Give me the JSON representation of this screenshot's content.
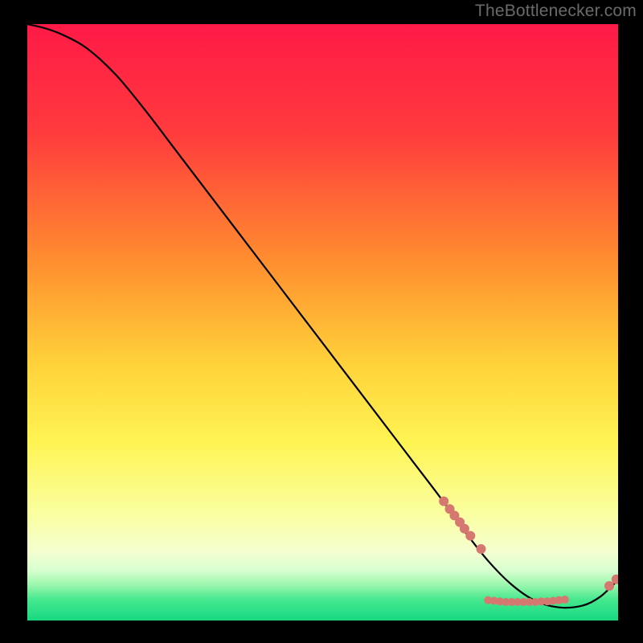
{
  "watermark": "TheBottlenecker.com",
  "chart_data": {
    "type": "line",
    "title": "",
    "xlabel": "",
    "ylabel": "",
    "xlim": [
      0,
      100
    ],
    "ylim": [
      0,
      100
    ],
    "gradient_stops": [
      {
        "offset": 0.0,
        "color": "#ff1a47"
      },
      {
        "offset": 0.18,
        "color": "#ff3a3d"
      },
      {
        "offset": 0.4,
        "color": "#ff8f2f"
      },
      {
        "offset": 0.57,
        "color": "#ffd23a"
      },
      {
        "offset": 0.7,
        "color": "#fff452"
      },
      {
        "offset": 0.82,
        "color": "#faffa0"
      },
      {
        "offset": 0.885,
        "color": "#f4ffd0"
      },
      {
        "offset": 0.915,
        "color": "#d9ffcf"
      },
      {
        "offset": 0.94,
        "color": "#9cf7ae"
      },
      {
        "offset": 0.965,
        "color": "#45e88e"
      },
      {
        "offset": 1.0,
        "color": "#17d981"
      }
    ],
    "series": [
      {
        "name": "curve",
        "x": [
          0,
          3,
          6,
          10,
          15,
          20,
          25,
          30,
          35,
          40,
          45,
          50,
          55,
          60,
          65,
          70,
          74,
          78,
          82,
          86,
          90,
          94,
          97,
          100
        ],
        "y": [
          100,
          99.3,
          98.2,
          96.0,
          91.5,
          85.5,
          79.0,
          72.5,
          66.0,
          59.5,
          53.0,
          46.5,
          40.0,
          33.5,
          27.0,
          20.5,
          15.0,
          10.0,
          6.0,
          3.3,
          2.2,
          2.5,
          4.0,
          6.8
        ]
      }
    ],
    "dot_clusters": [
      {
        "name": "upper-diagonal-cluster",
        "color": "#d57970",
        "r": 6,
        "points": [
          {
            "x": 70.5,
            "y": 20.0
          },
          {
            "x": 71.5,
            "y": 18.7
          },
          {
            "x": 72.3,
            "y": 17.6
          },
          {
            "x": 73.2,
            "y": 16.5
          },
          {
            "x": 74.0,
            "y": 15.4
          },
          {
            "x": 75.0,
            "y": 14.2
          },
          {
            "x": 76.8,
            "y": 12.0
          }
        ]
      },
      {
        "name": "bottom-dense-cluster",
        "color": "#d57970",
        "r": 5,
        "points": [
          {
            "x": 78.0,
            "y": 3.4
          },
          {
            "x": 79.0,
            "y": 3.3
          },
          {
            "x": 80.0,
            "y": 3.2
          },
          {
            "x": 81.0,
            "y": 3.1
          },
          {
            "x": 82.0,
            "y": 3.1
          },
          {
            "x": 83.0,
            "y": 3.1
          },
          {
            "x": 84.0,
            "y": 3.1
          },
          {
            "x": 85.0,
            "y": 3.1
          },
          {
            "x": 86.0,
            "y": 3.1
          },
          {
            "x": 87.0,
            "y": 3.2
          },
          {
            "x": 88.0,
            "y": 3.2
          },
          {
            "x": 89.0,
            "y": 3.3
          },
          {
            "x": 90.0,
            "y": 3.4
          },
          {
            "x": 91.0,
            "y": 3.5
          }
        ]
      },
      {
        "name": "right-pair",
        "color": "#d57970",
        "r": 6,
        "points": [
          {
            "x": 98.5,
            "y": 5.8
          },
          {
            "x": 99.7,
            "y": 6.9
          }
        ]
      }
    ]
  }
}
